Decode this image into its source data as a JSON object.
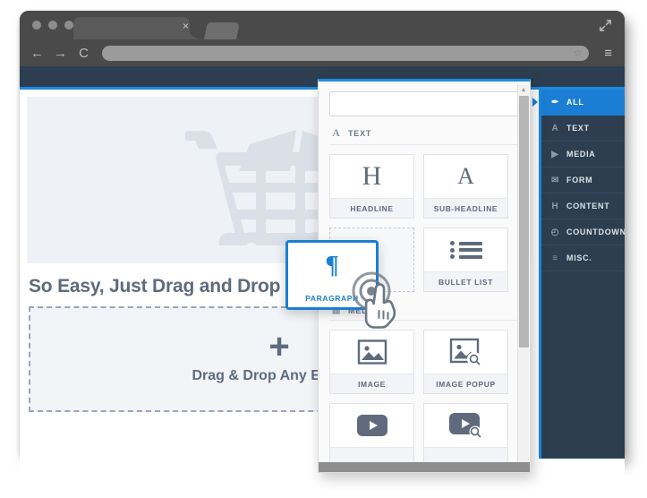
{
  "browser": {
    "tab_close_label": "×",
    "nav": {
      "back": "←",
      "forward": "→",
      "reload": "C",
      "star": "☆",
      "menu": "≡"
    },
    "address_value": ""
  },
  "canvas": {
    "hero_icon": "shopping-cart-icon",
    "headline": "So Easy, Just Drag and Drop",
    "dropzone": {
      "plus": "+",
      "label": "Drag & Drop Any Element"
    }
  },
  "sidemenu": {
    "items": [
      {
        "label": "ALL",
        "icon": "cursor-pointer-icon",
        "glyph": "✒",
        "active": true
      },
      {
        "label": "TEXT",
        "icon": "text-a-icon",
        "glyph": "A",
        "active": false
      },
      {
        "label": "MEDIA",
        "icon": "play-triangle-icon",
        "glyph": "▶",
        "active": false
      },
      {
        "label": "FORM",
        "icon": "envelope-icon",
        "glyph": "✉",
        "active": false
      },
      {
        "label": "CONTENT",
        "icon": "heading-h-icon",
        "glyph": "H",
        "active": false
      },
      {
        "label": "COUNTDOWN",
        "icon": "clock-icon",
        "glyph": "◴",
        "active": false
      },
      {
        "label": "MISC.",
        "icon": "list-lines-icon",
        "glyph": "≡",
        "active": false
      }
    ]
  },
  "panel": {
    "search_placeholder": "",
    "search_value": "",
    "categories": [
      {
        "label": "TEXT",
        "icon": "text-a-icon",
        "glyph": "A"
      },
      {
        "label": "MEDIA",
        "icon": "image-icon",
        "glyph": "▥"
      }
    ],
    "text_cards": [
      {
        "label": "HEADLINE",
        "icon": "heading-h-icon",
        "glyph": "H"
      },
      {
        "label": "SUB-HEADLINE",
        "icon": "subheading-a-icon",
        "glyph": "A"
      },
      {
        "label": "",
        "icon": "empty-slot-placeholder",
        "glyph": ""
      },
      {
        "label": "BULLET LIST",
        "icon": "bullet-list-icon",
        "glyph": ""
      }
    ],
    "media_cards": [
      {
        "label": "IMAGE",
        "icon": "image-icon",
        "glyph": ""
      },
      {
        "label": "IMAGE POPUP",
        "icon": "image-search-icon",
        "glyph": ""
      },
      {
        "label": "",
        "icon": "video-icon",
        "glyph": ""
      },
      {
        "label": "",
        "icon": "video-search-icon",
        "glyph": ""
      }
    ],
    "scrollbar": {
      "up_arrow": "▲"
    }
  },
  "drag": {
    "label": "PARAGRAPH",
    "icon": "pilcrow-icon",
    "glyph": "¶",
    "cursor": "pointing-hand-cursor"
  },
  "colors": {
    "accent_blue": "#1a7fd4",
    "rule_blue": "#1a8ae5",
    "dark_navy": "#2c3e50",
    "slate_text": "#5f6b7d",
    "chrome_gray": "#4a4a4a"
  }
}
